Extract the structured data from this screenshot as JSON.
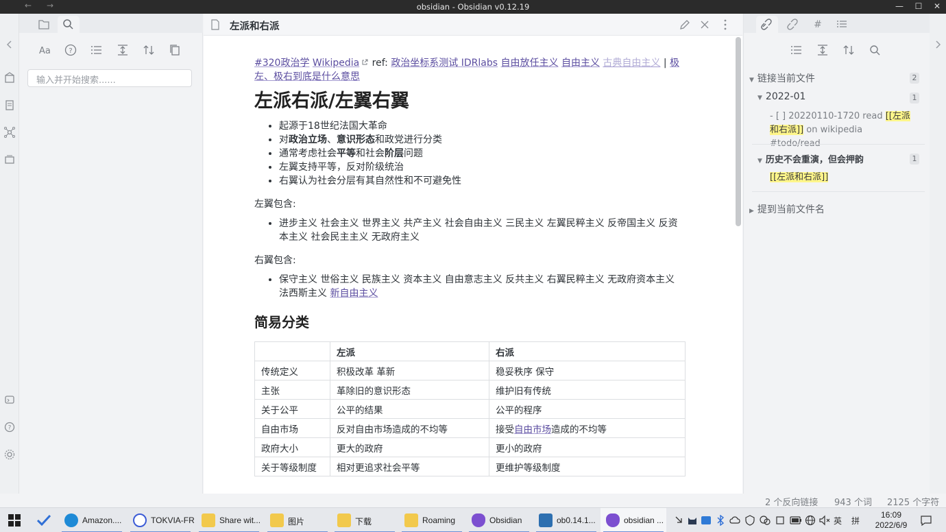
{
  "window": {
    "title": "obsidian - Obsidian v0.12.19",
    "back": "←",
    "forward": "→",
    "minimize": "—",
    "maximize": "☐",
    "close": "✕"
  },
  "left_sidebar": {
    "search_placeholder": "输入并开始搜索......"
  },
  "editor": {
    "file_title": "左派和右派",
    "tagline": {
      "tag1": "#320政治学",
      "link1": "Wikipedia",
      "ref_label": "ref:",
      "link2": "政治坐标系测试 IDRlabs",
      "link3": "自由放任主义",
      "link4": "自由主义",
      "link5": "古典自由主义",
      "pipe": "|",
      "link6": "极左、极右到底是什么意思"
    },
    "h1": "左派右派/左翼右翼",
    "bullets": {
      "b1": "起源于18世纪法国大革命",
      "b2_pre": "对",
      "b2_bold1": "政治立场",
      "b2_sep": "、",
      "b2_bold2": "意识形态",
      "b2_post": "和政党进行分类",
      "b3_pre": "通常考虑社会",
      "b3_bold1": "平等",
      "b3_mid": "和社会",
      "b3_bold2": "阶层",
      "b3_post": "问题",
      "b4": "左翼支持平等，反对阶级统治",
      "b5": "右翼认为社会分层有其自然性和不可避免性"
    },
    "left_includes_label": "左翼包含:",
    "left_includes": "进步主义 社会主义 世界主义 共产主义 社会自由主义 三民主义 左翼民粹主义 反帝国主义 反资本主义 社会民主主义 无政府主义",
    "right_includes_label": "右翼包含:",
    "right_includes": "保守主义 世俗主义 民族主义 资本主义 自由意志主义 反共主义 右翼民粹主义 无政府资本主义 法西斯主义",
    "right_includes_link": "新自由主义",
    "h2": "简易分类",
    "table": {
      "headers": [
        "",
        "左派",
        "右派"
      ],
      "rows": [
        [
          "传统定义",
          "积极改革 革新",
          "稳妥秩序 保守"
        ],
        [
          "主张",
          "革除旧的意识形态",
          "维护旧有传统"
        ],
        [
          "关于公平",
          "公平的结果",
          "公平的程序"
        ],
        [
          "自由市场",
          "反对自由市场造成的不均等",
          "接受",
          "自由市场",
          "造成的不均等"
        ],
        [
          "政府大小",
          "更大的政府",
          "更小的政府"
        ],
        [
          "关于等级制度",
          "相对更追求社会平等",
          "更维护等级制度"
        ]
      ]
    }
  },
  "right_sidebar": {
    "linked_section": "链接当前文件",
    "linked_count": "2",
    "group1_title": "2022-01",
    "group1_count": "1",
    "group1_text_pre": "- [ ] 20220110-1720 read",
    "group1_highlight": "[[左派和右派]]",
    "group1_text_post": "on wikipedia #todo/read",
    "group2_title": "历史不会重演，但会押韵",
    "group2_count": "1",
    "group2_highlight": "[[左派和右派]]",
    "unlinked_section": "提到当前文件名"
  },
  "status": {
    "backlinks": "2 个反向链接",
    "words": "943 个词",
    "chars": "2125 个字符"
  },
  "taskbar": {
    "items": [
      "Amazon....",
      "TOKVIA-FR",
      "Share wit...",
      "图片",
      "下载",
      "Roaming",
      "Obsidian",
      "ob0.14.1...",
      "obsidian ..."
    ],
    "ime": "英",
    "ime2": "拼",
    "time": "16:09",
    "date": "2022/6/9"
  },
  "colors": {
    "accent": "#5b4da0",
    "highlight": "#fff68a",
    "titlebar": "#2b2b2b"
  }
}
